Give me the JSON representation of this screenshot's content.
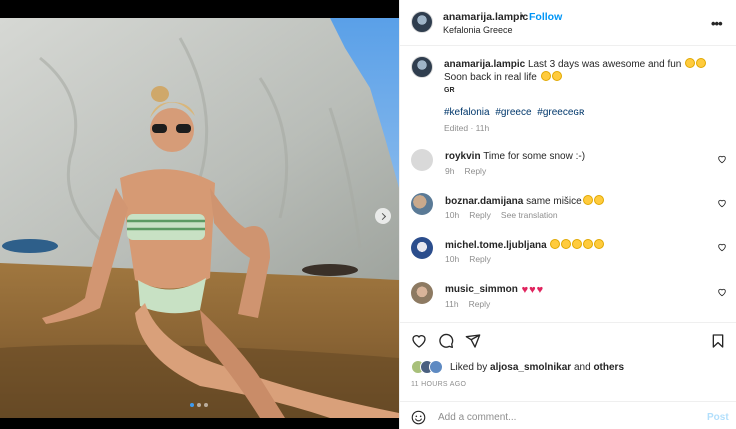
{
  "header": {
    "username": "anamarija.lampic",
    "separator": "•",
    "follow_label": "Follow",
    "location": "Kefalonia Greece",
    "more_icon": "more-horizontal-icon"
  },
  "caption": {
    "username": "anamarija.lampic",
    "text_line1": "Last 3 days was awesome and fun",
    "text_line2": "Soon back in real life",
    "emoji_line1": "heart-eyes-emoji heart-eyes-emoji",
    "emoji_line2": "wink-emoji flexed-biceps-emoji",
    "badge": "GR",
    "hashtags": [
      "#kefalonia",
      "#greece",
      "#greeceɢʀ"
    ],
    "edited": "Edited",
    "edited_time": "11h"
  },
  "comments": [
    {
      "username": "roykvin",
      "text": "Time for some snow :-)",
      "time": "9h",
      "reply": "Reply",
      "translate": ""
    },
    {
      "username": "boznar.damijana",
      "text": "same mišice",
      "time": "10h",
      "reply": "Reply",
      "translate": "See translation"
    },
    {
      "username": "michel.tome.ljubljana",
      "text": "",
      "time": "10h",
      "reply": "Reply",
      "translate": ""
    },
    {
      "username": "music_simmon",
      "text": "",
      "time": "11h",
      "reply": "Reply",
      "translate": ""
    }
  ],
  "actions": {
    "like_icon": "heart-outline-icon",
    "comment_icon": "comment-icon",
    "share_icon": "paper-plane-icon",
    "save_icon": "bookmark-icon"
  },
  "likes": {
    "prefix": "Liked by",
    "user": "aljosa_smolnikar",
    "and": "and",
    "others": "others"
  },
  "timestamp": "11 HOURS AGO",
  "add_comment": {
    "placeholder": "Add a comment...",
    "post_label": "Post",
    "emoji_icon": "smiley-icon"
  },
  "carousel": {
    "slide_count": 3,
    "active_index": 0
  },
  "colors": {
    "link_blue": "#0095f6",
    "hashtag": "#00376b",
    "muted": "#8e8e8e",
    "post_disabled": "#b2dffc"
  }
}
